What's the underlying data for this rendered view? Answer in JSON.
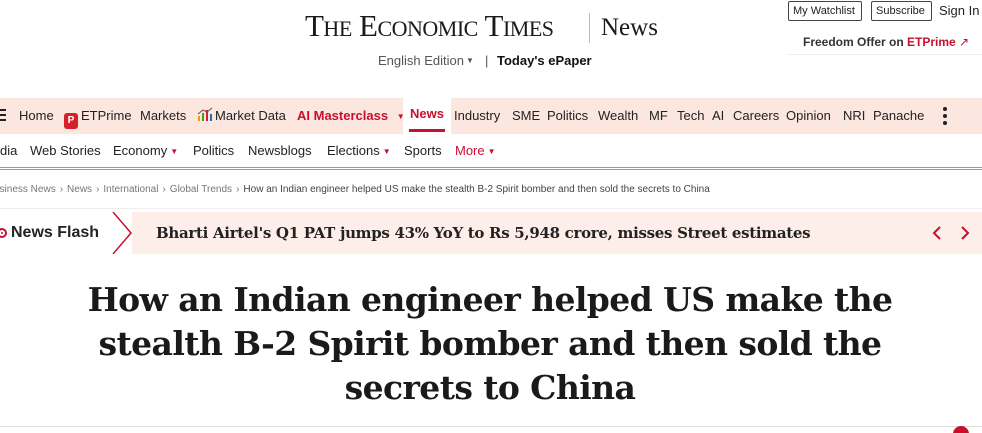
{
  "masthead": {
    "logo_text": "The Economic Times",
    "section": "News",
    "edition_label": "English Edition",
    "separator": "|",
    "epaper_label": "Today's ePaper",
    "watchlist_label": "My Watchlist",
    "subscribe_label": "Subscribe",
    "signin_label": "Sign In",
    "offer_prefix": "Freedom Offer on ",
    "offer_brand": "ETPrime",
    "offer_arrow": "↗"
  },
  "main_nav": {
    "items": [
      {
        "label": "Home"
      },
      {
        "label": "ETPrime"
      },
      {
        "label": "Markets"
      },
      {
        "label": "Market Data"
      },
      {
        "label": "AI Masterclass"
      },
      {
        "label": "News"
      },
      {
        "label": "Industry"
      },
      {
        "label": "SME"
      },
      {
        "label": "Politics"
      },
      {
        "label": "Wealth"
      },
      {
        "label": "MF"
      },
      {
        "label": "Tech"
      },
      {
        "label": "AI"
      },
      {
        "label": "Careers"
      },
      {
        "label": "Opinion"
      },
      {
        "label": "NRI"
      },
      {
        "label": "Panache"
      }
    ],
    "active": "News",
    "accent_color": "#c8102e",
    "background_color": "#fbe6e0"
  },
  "sub_nav": {
    "items": [
      {
        "label": "dia"
      },
      {
        "label": "Web Stories"
      },
      {
        "label": "Economy"
      },
      {
        "label": "Politics"
      },
      {
        "label": "Newsblogs"
      },
      {
        "label": "Elections"
      },
      {
        "label": "Sports"
      },
      {
        "label": "More"
      }
    ]
  },
  "breadcrumb": {
    "items": [
      "usiness News",
      "News",
      "International",
      "Global Trends"
    ],
    "current": "How an Indian engineer helped US make the stealth B-2 Spirit bomber and then sold the secrets to China"
  },
  "news_flash": {
    "label": "News Flash",
    "headline": "Bharti Airtel's Q1 PAT jumps 43% YoY to Rs 5,948 crore, misses Street estimates",
    "prev_icon": "chevron-left-icon",
    "next_icon": "chevron-right-icon"
  },
  "article": {
    "title": "How an Indian engineer helped US make the stealth B-2 Spirit bomber and then sold the secrets to China"
  }
}
